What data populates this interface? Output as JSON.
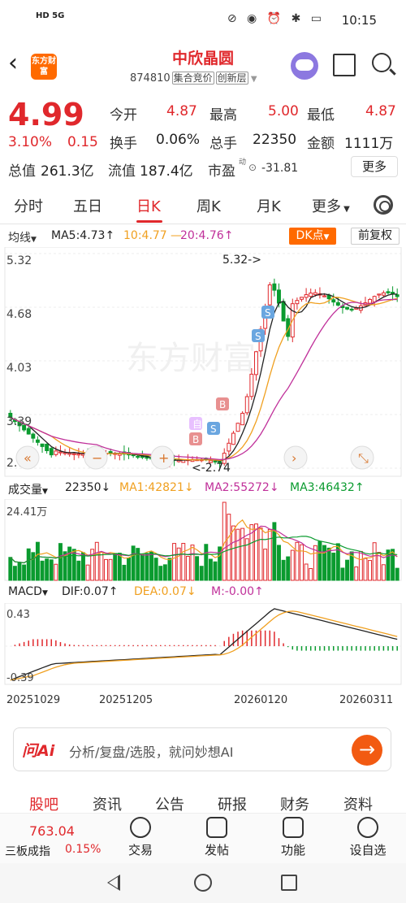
{
  "statusbar": {
    "signal": "HD 5G",
    "time": "10:15",
    "icons": "⊘ ◉ ⏰ ✱ ▭"
  },
  "header": {
    "logo": "东方财富",
    "stock_name": "中欣晶圆",
    "code": "874810",
    "tag1": "集合竞价",
    "tag2": "创新层",
    "back_icon": "back-arrow-icon",
    "share_icon": "share-icon",
    "search_icon": "search-icon"
  },
  "quote": {
    "price": "4.99",
    "change_pct": "3.10%",
    "change": "0.15",
    "open_label": "今开",
    "open": "4.87",
    "high_label": "最高",
    "high": "5.00",
    "low_label": "最低",
    "low": "4.87",
    "turnover_label": "换手",
    "turnover": "0.06%",
    "volume_label": "总手",
    "volume": "22350",
    "amount_label": "金额",
    "amount": "1111万",
    "mktcap_label": "总值",
    "mktcap": "261.3亿",
    "float_label": "流值",
    "float": "187.4亿",
    "pe_label": "市盈",
    "pe_sup": "动",
    "pe": "-31.81",
    "more": "更多"
  },
  "tabs": [
    "分时",
    "五日",
    "日K",
    "周K",
    "月K",
    "更多"
  ],
  "active_tab": "日K",
  "ma_legend": {
    "selector": "均线",
    "ma5": "MA5:4.73↑",
    "ma10_20": "10:4.77",
    "ma20": "20:4.76↑",
    "dk": "DK点",
    "fq": "前复权"
  },
  "kline": {
    "y_labels": [
      "5.32",
      "4.68",
      "4.03",
      "3.39",
      "2.74"
    ],
    "high_mark": "5.32->",
    "low_mark": "<-2.74",
    "watermark": "东方财富",
    "signal_b": "B",
    "signal_s": "S",
    "signal_zi": "自"
  },
  "vol_legend": {
    "selector": "成交量",
    "vol": "22350↓",
    "ma1": "MA1:42821↓",
    "ma2": "MA2:55272↓",
    "ma3": "MA3:46432↑",
    "max": "24.41万"
  },
  "macd_legend": {
    "selector": "MACD",
    "dif": "DIF:0.07↑",
    "dea": "DEA:0.07↓",
    "m": "M:-0.00↑",
    "max": "0.43",
    "min": "-0.39"
  },
  "x_dates": [
    "20251029",
    "20251205",
    "20260120",
    "20260311"
  ],
  "ai": {
    "logo": "问Ai",
    "placeholder": "分析/复盘/选股，就问妙想AI",
    "go": "→"
  },
  "info_tabs": [
    "股吧",
    "资讯",
    "公告",
    "研报",
    "财务",
    "资料"
  ],
  "bottom": {
    "index_price": "763.04",
    "index_name": "三板成指",
    "index_pct": "0.15%",
    "nav": [
      "交易",
      "发帖",
      "功能",
      "设自选"
    ]
  },
  "colors": {
    "up": "#e0282c",
    "down": "#0a9b2f",
    "ma5": "#222222",
    "ma10": "#f0a020",
    "ma20": "#c0309a",
    "accent": "#ff6a00"
  }
}
